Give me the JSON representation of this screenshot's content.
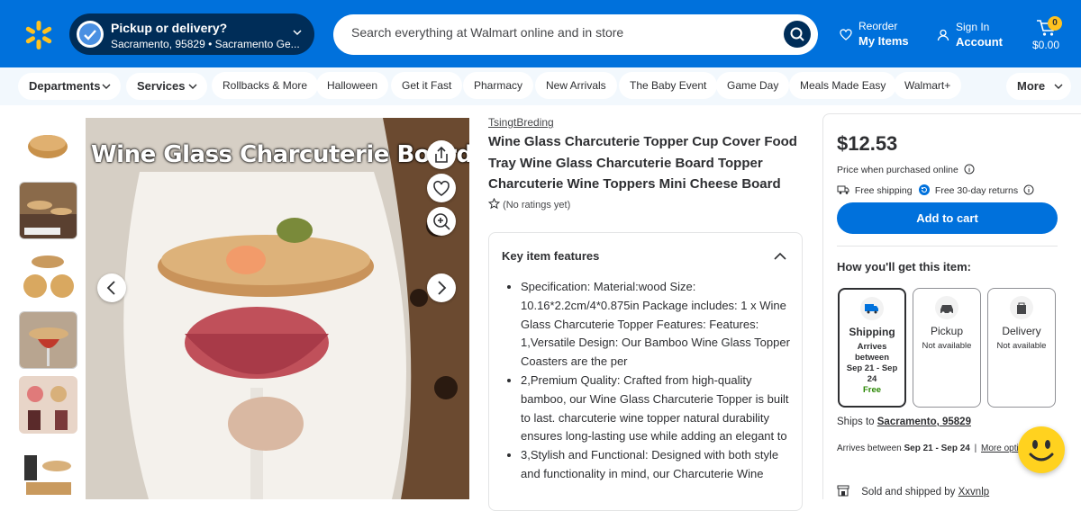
{
  "header": {
    "pickup_title": "Pickup or delivery?",
    "pickup_location": "Sacramento, 95829 • Sacramento Ge...",
    "search_placeholder": "Search everything at Walmart online and in store",
    "reorder_label": "Reorder",
    "my_items_label": "My Items",
    "signin_label": "Sign In",
    "account_label": "Account",
    "cart_count": "0",
    "cart_total": "$0.00"
  },
  "nav": {
    "departments": "Departments",
    "services": "Services",
    "items": [
      "Rollbacks & More",
      "Halloween",
      "Get it Fast",
      "Pharmacy",
      "New Arrivals",
      "The Baby Event",
      "Game Day",
      "Meals Made Easy",
      "Walmart+"
    ],
    "more": "More"
  },
  "product": {
    "image_caption": "Wine Glass Charcuterie Board Topper",
    "brand": "TsingtBreding",
    "title": "Wine Glass Charcuterie Topper Cup Cover Food Tray Wine Glass Charcuterie Board Topper Charcuterie Wine Toppers Mini Cheese Board",
    "rating_text": "(No ratings yet)",
    "features_heading": "Key item features",
    "features": [
      "Specification: Material:wood Size: 10.16*2.2cm/4*0.875in Package includes: 1 x Wine Glass Charcuterie Topper Features: Features: 1,Versatile Design: Our Bamboo Wine Glass Topper Coasters are the per",
      "2,Premium Quality: Crafted from high-quality bamboo, our Wine Glass Charcuterie Topper is built to last. charcuterie wine topper natural durability ensures long-lasting use while adding an elegant to",
      "3,Stylish and Functional: Designed with both style and functionality in mind, our Charcuterie Wine"
    ]
  },
  "buybox": {
    "price": "$12.53",
    "price_note": "Price when purchased online",
    "free_shipping": "Free shipping",
    "free_returns": "Free 30-day returns",
    "add_to_cart": "Add to cart",
    "how_heading": "How you'll get this item:",
    "options": [
      {
        "name": "Shipping",
        "line1": "Arrives",
        "line2": "between",
        "line3": "Sep 21 - Sep",
        "line4": "24",
        "line5": "Free"
      },
      {
        "name": "Pickup",
        "line1": "Not available"
      },
      {
        "name": "Delivery",
        "line1": "Not available"
      }
    ],
    "ships_to_label": "Ships to",
    "ships_to_location": "Sacramento, 95829",
    "arrives_label": "Arrives between",
    "arrives_dates": "Sep 21 - Sep 24",
    "more_options": "More opti",
    "sold_by_label": "Sold and shipped by",
    "seller": "Xxvnlp"
  },
  "colors": {
    "brand_blue": "#0071dc",
    "dark_navy": "#002d58",
    "spark_yellow": "#ffc220",
    "nav_bg": "#f2f8fd"
  }
}
